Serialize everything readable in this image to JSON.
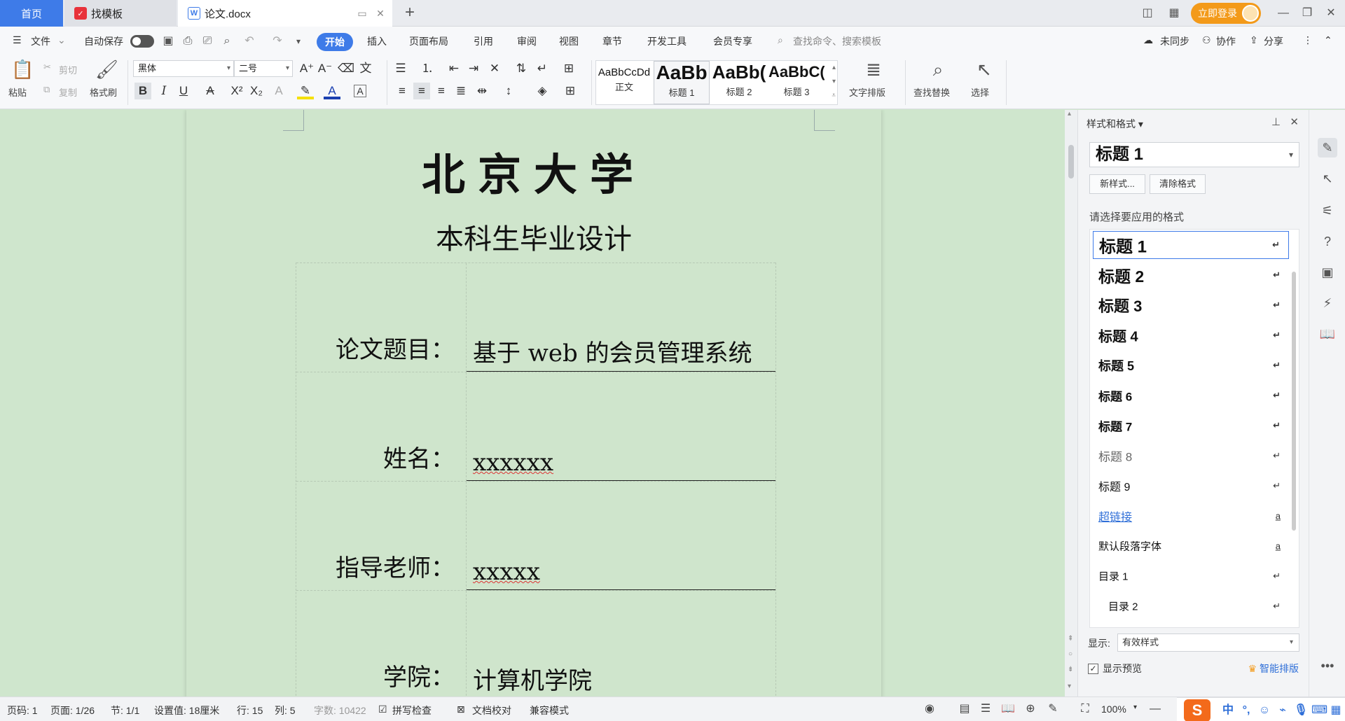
{
  "tabs": {
    "home": "首页",
    "template": "找模板",
    "doc": "论文.docx"
  },
  "login": "立即登录",
  "menu": {
    "file": "文件",
    "autosave": "自动保存",
    "items": [
      "开始",
      "插入",
      "页面布局",
      "引用",
      "审阅",
      "视图",
      "章节",
      "开发工具",
      "会员专享"
    ],
    "search": "查找命令、搜索模板",
    "unsync": "未同步",
    "collab": "协作",
    "share": "分享"
  },
  "ribbon": {
    "paste": "粘贴",
    "cut": "剪切",
    "copy": "复制",
    "format_painter": "格式刷",
    "font": "黑体",
    "size": "二号",
    "styles": [
      {
        "sample": "AaBbCcDd",
        "name": "正文"
      },
      {
        "sample": "AaBb",
        "name": "标题 1"
      },
      {
        "sample": "AaBb(",
        "name": "标题 2"
      },
      {
        "sample": "AaBbC(",
        "name": "标题 3"
      }
    ],
    "text_layout": "文字排版",
    "find_replace": "查找替换",
    "select": "选择"
  },
  "document": {
    "university": "北京大学",
    "subtitle": "本科生毕业设计",
    "rows": [
      {
        "label": "论文题目：",
        "value": "基于 web 的会员管理系统",
        "squiggle": false
      },
      {
        "label": "姓名：",
        "value": "xxxxxx",
        "squiggle": true
      },
      {
        "label": "指导老师：",
        "value": "xxxxx",
        "squiggle": true
      },
      {
        "label": "学院：",
        "value": "计算机学院",
        "squiggle": false
      }
    ]
  },
  "panel": {
    "title": "样式和格式",
    "current": "标题 1",
    "new_style": "新样式...",
    "clear_format": "清除格式",
    "prompt": "请选择要应用的格式",
    "styles": [
      {
        "name": "标题 1",
        "mark": "↵"
      },
      {
        "name": "标题 2",
        "mark": "↵"
      },
      {
        "name": "标题 3",
        "mark": "↵"
      },
      {
        "name": "标题 4",
        "mark": "↵"
      },
      {
        "name": "标题 5",
        "mark": "↵"
      },
      {
        "name": "标题 6",
        "mark": "↵"
      },
      {
        "name": "标题 7",
        "mark": "↵"
      },
      {
        "name": "标题 8",
        "mark": "↵"
      },
      {
        "name": "标题 9",
        "mark": "↵"
      },
      {
        "name": "超链接",
        "mark": "a"
      },
      {
        "name": "默认段落字体",
        "mark": "a"
      },
      {
        "name": "目录 1",
        "mark": "↵"
      },
      {
        "name": "目录 2",
        "mark": "↵"
      }
    ],
    "show_label": "显示:",
    "show_value": "有效样式",
    "preview": "显示预览",
    "smart_layout": "智能排版"
  },
  "status": {
    "page_code": "页码: 1",
    "page": "页面: 1/26",
    "section": "节: 1/1",
    "setting": "设置值: 18厘米",
    "line": "行: 15",
    "col": "列: 5",
    "words": "字数: 10422",
    "spell": "拼写检查",
    "proof": "文档校对",
    "compat": "兼容模式",
    "zoom": "100%"
  },
  "colors": {
    "accent": "#3e7be8",
    "login": "#f39a1a",
    "page_bg": "#cfe5cc",
    "link": "#2f6fd8"
  }
}
